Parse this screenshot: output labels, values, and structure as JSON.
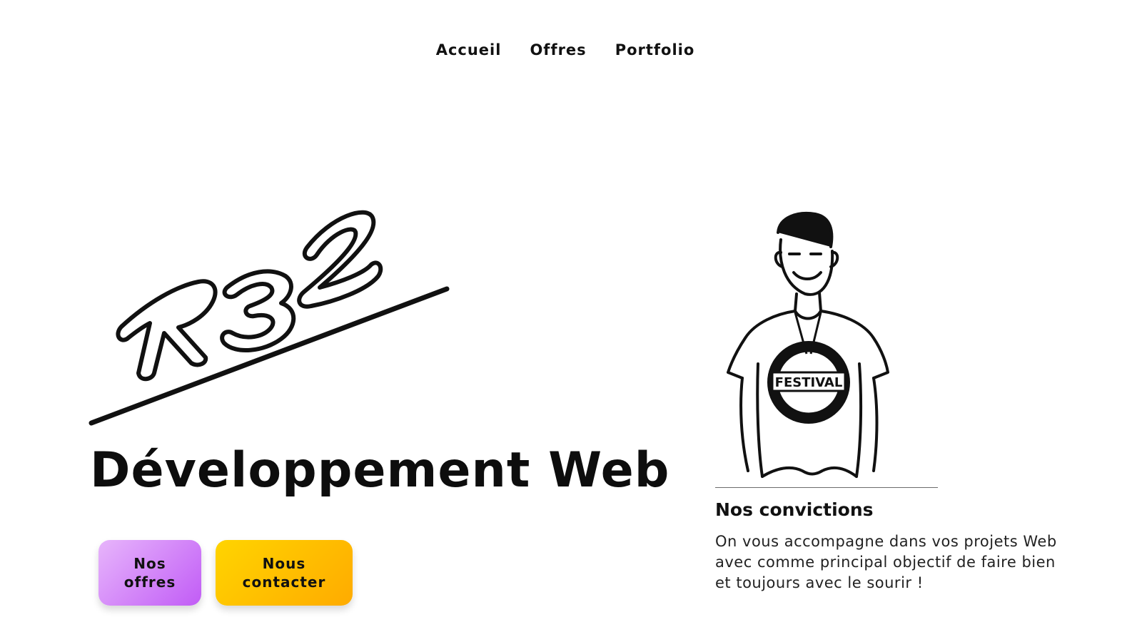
{
  "nav": {
    "items": [
      {
        "label": "Accueil"
      },
      {
        "label": "Offres"
      },
      {
        "label": "Portfolio"
      }
    ]
  },
  "logo": {
    "text": "R32"
  },
  "hero": {
    "title": "Développement Web",
    "buttons": {
      "offres_label": "Nos\noffres",
      "contact_label": "Nous\ncontacter"
    }
  },
  "convictions": {
    "title": "Nos convictions",
    "text": "On vous accompagne dans vos projets Web avec comme principal objectif de faire bien et toujours avec le sourir !"
  },
  "portrait": {
    "shirt_text": "FESTIVAL"
  },
  "colors": {
    "accent_purple_start": "#e7b5fb",
    "accent_purple_end": "#c15cf6",
    "accent_yellow_start": "#ffd400",
    "accent_yellow_end": "#ffab00"
  }
}
